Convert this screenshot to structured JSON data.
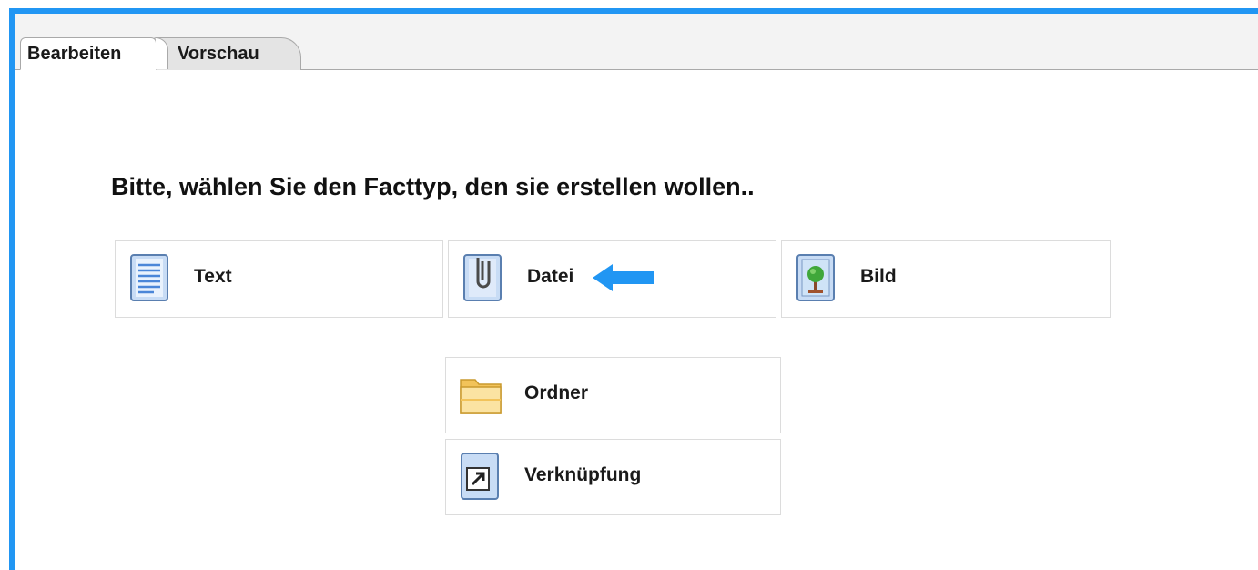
{
  "tabs": [
    {
      "label": "Bearbeiten",
      "active": true
    },
    {
      "label": "Vorschau",
      "active": false
    }
  ],
  "heading": "Bitte, wählen Sie den Facttyp, den sie erstellen wollen..",
  "fact_types": {
    "text": {
      "label": "Text",
      "icon": "text-document-icon"
    },
    "datei": {
      "label": "Datei",
      "icon": "file-attachment-icon"
    },
    "bild": {
      "label": "Bild",
      "icon": "image-picture-icon"
    },
    "ordner": {
      "label": "Ordner",
      "icon": "folder-icon"
    },
    "verknuepfung": {
      "label": "Verknüpfung",
      "icon": "shortcut-link-icon"
    }
  },
  "annotation": {
    "icon": "arrow-left-icon",
    "color": "#2196f3"
  },
  "colors": {
    "accent": "#2196f3"
  }
}
